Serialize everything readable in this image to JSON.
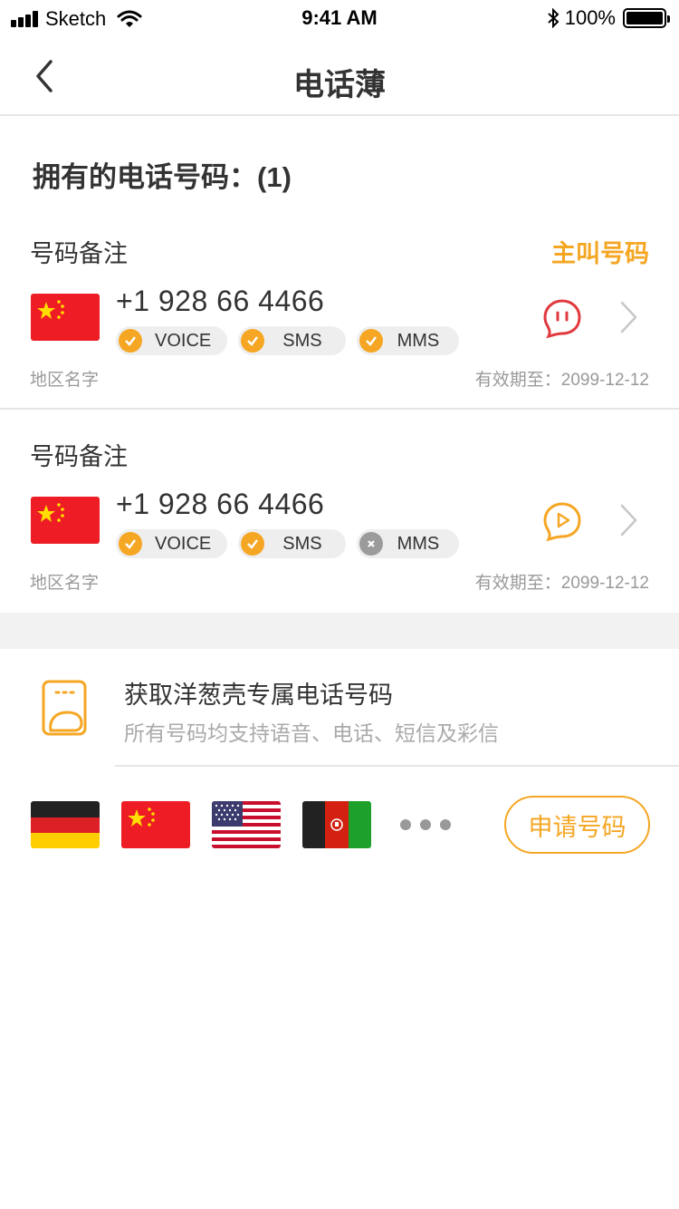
{
  "status_bar": {
    "carrier": "Sketch",
    "time": "9:41 AM",
    "battery": "100%"
  },
  "nav": {
    "title": "电话薄"
  },
  "section_title": "拥有的电话号码：(1)",
  "numbers": [
    {
      "note": "号码备注",
      "badge": "主叫号码",
      "number": "+1 928 66 4466",
      "flag": "china-flag",
      "tags": [
        {
          "label": "VOICE",
          "enabled": true
        },
        {
          "label": "SMS",
          "enabled": true
        },
        {
          "label": "MMS",
          "enabled": true
        }
      ],
      "region": "地区名字",
      "expiry": "有效期至：2099-12-12",
      "action_icon": "chat-bubble-icon",
      "action_color": "#e0393e"
    },
    {
      "note": "号码备注",
      "number": "+1 928 66 4466",
      "flag": "china-flag",
      "tags": [
        {
          "label": "VOICE",
          "enabled": true
        },
        {
          "label": "SMS",
          "enabled": true
        },
        {
          "label": "MMS",
          "enabled": false
        }
      ],
      "region": "地区名字",
      "expiry": "有效期至：2099-12-12",
      "action_icon": "play-bubble-icon",
      "action_color": "#f5a623"
    }
  ],
  "promo": {
    "title": "获取洋葱壳专属电话号码",
    "subtitle": "所有号码均支持语音、电话、短信及彩信",
    "flags": [
      "germany-flag",
      "china-flag",
      "usa-flag",
      "afghanistan-flag"
    ],
    "apply_label": "申请号码"
  },
  "colors": {
    "accent": "#f5a623",
    "danger": "#e0393e",
    "muted": "#999999"
  }
}
